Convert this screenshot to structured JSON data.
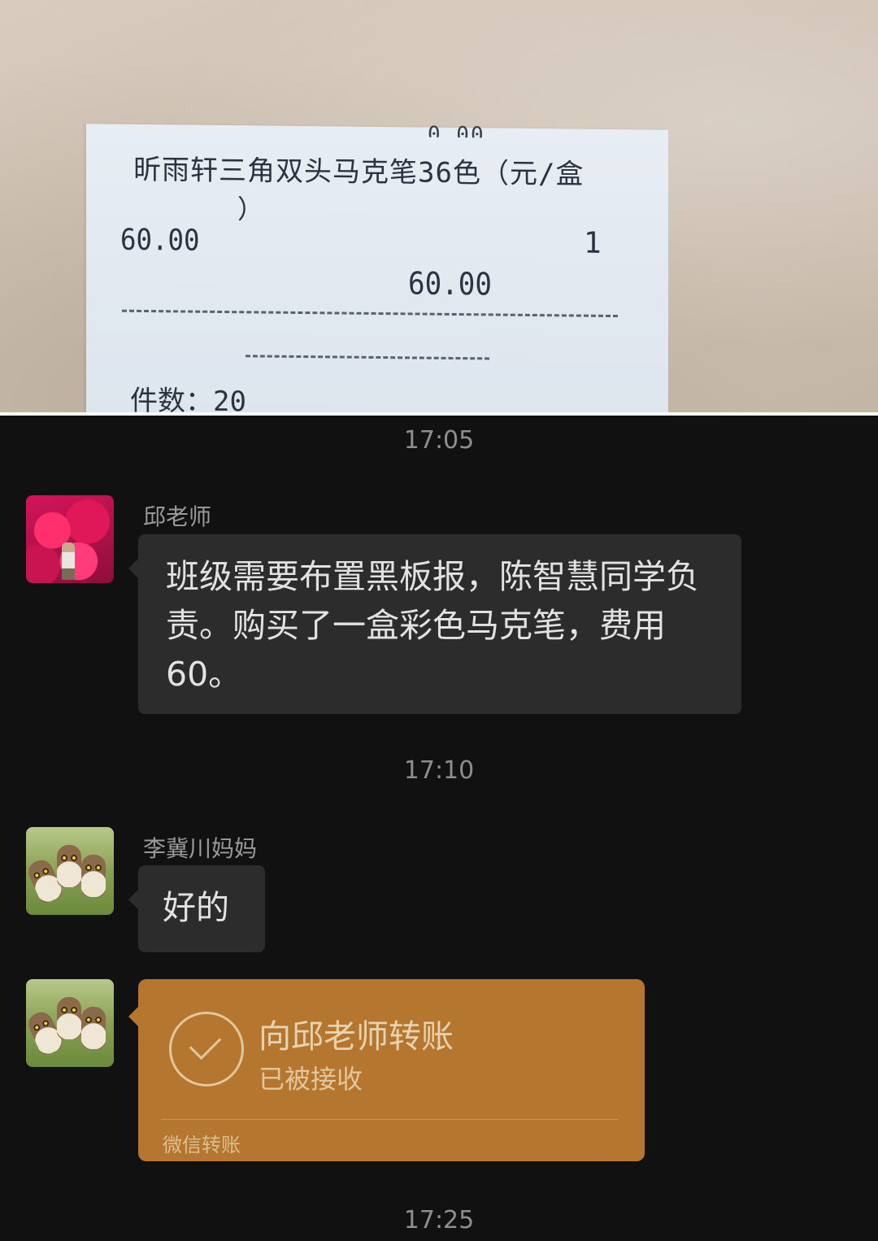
{
  "receipt": {
    "top_fragment": "0.00",
    "item_line1": "昕雨轩三角双头马克笔36色（元/盒",
    "item_line2": "）",
    "unit_price": "60.00",
    "quantity": "1",
    "line_total": "60.00",
    "item_count": "件数：20"
  },
  "chat": {
    "messages": [
      {
        "time": "17:05",
        "sender": "邱老师",
        "text": "班级需要布置黑板报，陈智慧同学负责。购买了一盒彩色马克笔，费用60。"
      },
      {
        "time": "17:10",
        "sender": "李冀川妈妈",
        "text": "好的"
      }
    ],
    "transfer": {
      "title": "向邱老师转账",
      "status": "已被接收",
      "label": "微信转账",
      "color": "#b5772f"
    },
    "last_time": "17:25"
  }
}
